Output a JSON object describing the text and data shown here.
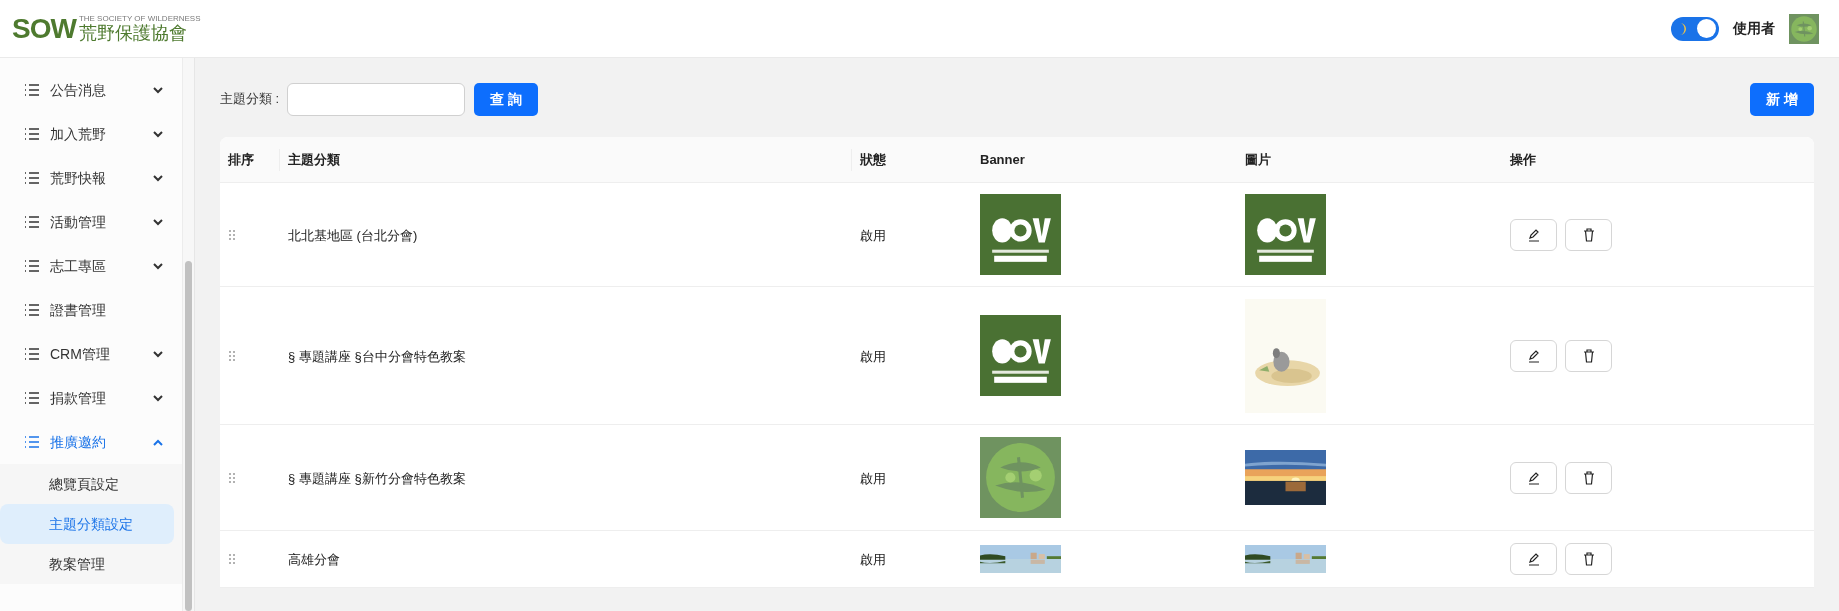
{
  "header": {
    "logo": {
      "mark": "SOW",
      "tagline": "THE SOCIETY OF WILDERNESS",
      "name": "荒野保護協會"
    },
    "dark_mode_toggle": {
      "on": true
    },
    "user": "使用者"
  },
  "sidebar": {
    "items": [
      {
        "label": "公告消息",
        "kind": "group",
        "expanded": false,
        "selected": false
      },
      {
        "label": "加入荒野",
        "kind": "group",
        "expanded": false,
        "selected": false
      },
      {
        "label": "荒野快報",
        "kind": "group",
        "expanded": false,
        "selected": false
      },
      {
        "label": "活動管理",
        "kind": "group",
        "expanded": false,
        "selected": false
      },
      {
        "label": "志工專區",
        "kind": "group",
        "expanded": false,
        "selected": false
      },
      {
        "label": "證書管理",
        "kind": "link",
        "selected": false
      },
      {
        "label": "CRM管理",
        "kind": "group",
        "expanded": false,
        "selected": false
      },
      {
        "label": "捐款管理",
        "kind": "group",
        "expanded": false,
        "selected": false
      },
      {
        "label": "推廣邀約",
        "kind": "group",
        "expanded": true,
        "selected": true,
        "children": [
          {
            "label": "總覽頁設定",
            "selected": false
          },
          {
            "label": "主題分類設定",
            "selected": true
          },
          {
            "label": "教案管理",
            "selected": false
          }
        ]
      }
    ]
  },
  "filter": {
    "label": "主題分類 :",
    "search_button": "查 詢",
    "add_button": "新 增"
  },
  "table": {
    "columns": [
      "排序",
      "主題分類",
      "狀態",
      "Banner",
      "圖片",
      "操作"
    ],
    "rows": [
      {
        "category": "北北基地區 (台北分會)",
        "status": "啟用"
      },
      {
        "category": "§ 專題講座 §台中分會特色教案",
        "status": "啟用"
      },
      {
        "category": "§ 專題講座 §新竹分會特色教案",
        "status": "啟用"
      },
      {
        "category": "高雄分會",
        "status": "啟用"
      }
    ]
  }
}
